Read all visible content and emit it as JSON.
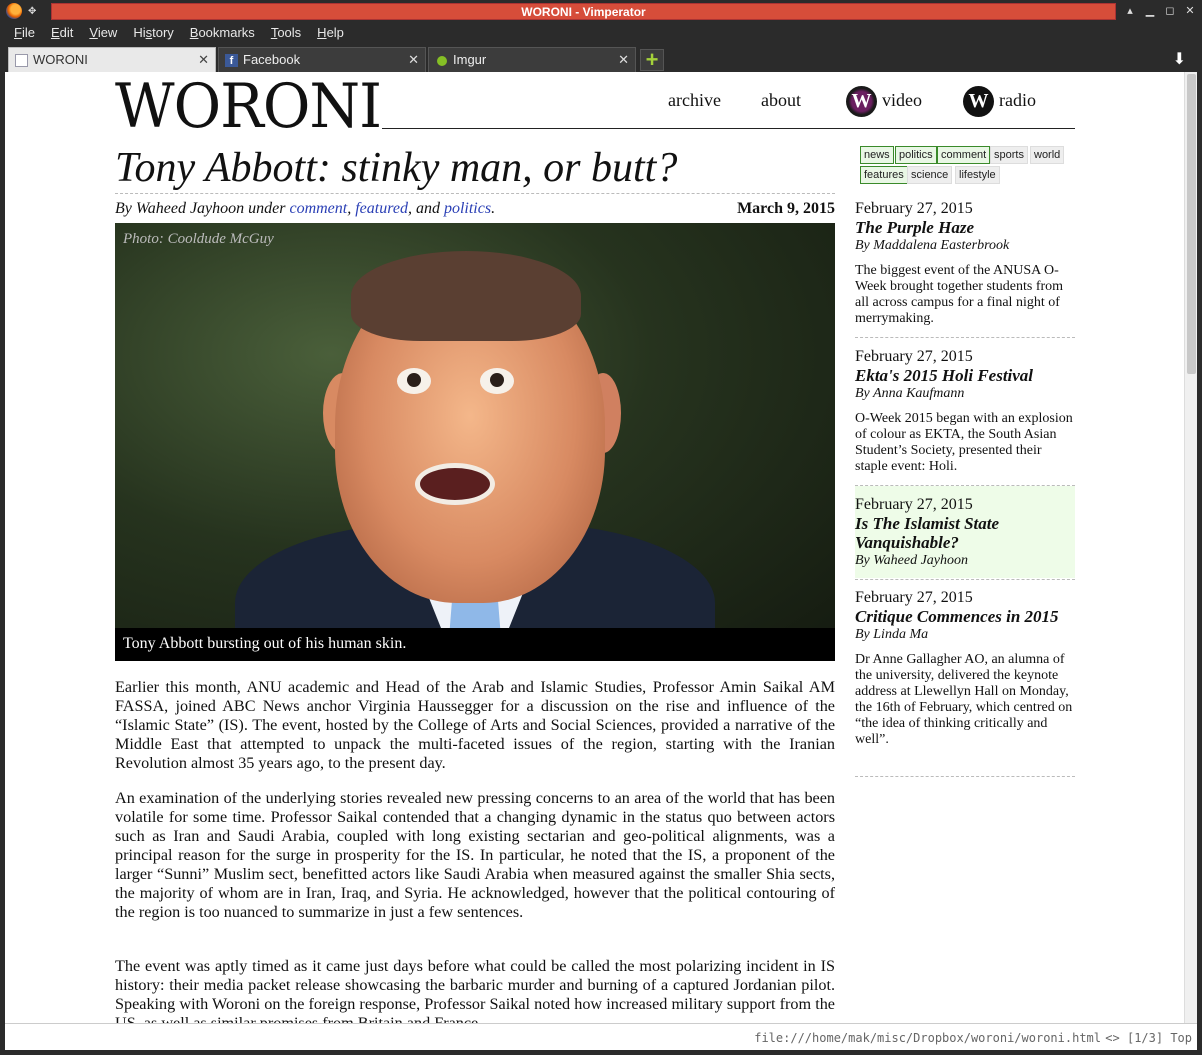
{
  "window": {
    "title": "WORONI - Vimperator"
  },
  "menubar": [
    {
      "mn": "F",
      "rest": "ile"
    },
    {
      "mn": "E",
      "rest": "dit"
    },
    {
      "mn": "V",
      "rest": "iew"
    },
    {
      "pre": "Hi",
      "mn": "s",
      "rest": "tory"
    },
    {
      "mn": "B",
      "rest": "ookmarks"
    },
    {
      "mn": "T",
      "rest": "ools"
    },
    {
      "mn": "H",
      "rest": "elp"
    }
  ],
  "tabs": [
    {
      "label": "WORONI",
      "icon": "page-icon"
    },
    {
      "label": "Facebook",
      "icon": "facebook-icon"
    },
    {
      "label": "Imgur",
      "icon": "imgur-icon"
    }
  ],
  "site": {
    "logo": "WORONI",
    "nav": {
      "archive": "archive",
      "about": "about",
      "video": "video",
      "radio": "radio",
      "badge": "W"
    }
  },
  "article": {
    "title": "Tony Abbott: stinky man, or butt?",
    "byline_prefix": "By Waheed Jayhoon under ",
    "cat1": "comment",
    "sep1": ", ",
    "cat2": "featured",
    "sep2": ", and ",
    "cat3": "politics",
    "byline_end": ".",
    "date": "March 9, 2015",
    "photo_credit": "Photo: Cooldude McGuy",
    "caption": "Tony Abbott bursting out of his human skin.",
    "paragraphs": [
      "Earlier this month, ANU academic and Head of the Arab and Islamic Studies, Professor Amin Saikal AM FASSA, joined ABC News anchor Virginia Haussegger for a discussion on the rise and influence of the “Islamic State” (IS). The event, hosted by the College of Arts and Social Sciences, provided a narrative of the Middle East that attempted to unpack the multi-faceted issues of the region, starting with the Iranian Revolution almost 35 years ago, to the present day.",
      "An examination of the underlying stories revealed new pressing concerns to an area of the world that has been volatile for some time. Professor Saikal contended that a changing dynamic in the status quo between actors such as Iran and Saudi Arabia, coupled with long existing sectarian and geo-political alignments, was a principal reason for the surge in prosperity for the IS. In particular, he noted that the IS, a proponent of the larger “Sunni” Muslim sect, benefitted actors like Saudi Arabia when measured against the smaller Shia sects, the majority of whom are in Iran, Iraq, and Syria. He acknowledged, however that the political contouring of the region is too nuanced to summarize in just a few sentences.",
      "The event was aptly timed as it came just days before what could be called the most polarizing incident in IS history: their media packet release showcasing the barbaric murder and burning of a captured Jordanian pilot. Speaking with Woroni on the foreign response, Professor Saikal noted how increased military support from the US, as well as similar promises from Britain and France"
    ]
  },
  "sidebar": {
    "tags": [
      {
        "label": "news",
        "active": true
      },
      {
        "label": "politics",
        "active": true
      },
      {
        "label": "comment",
        "active": true
      },
      {
        "label": "sports",
        "active": false
      },
      {
        "label": "world",
        "active": false
      },
      {
        "label": "features",
        "active": true
      },
      {
        "label": "science",
        "active": false
      },
      {
        "label": "lifestyle",
        "active": false
      }
    ],
    "items": [
      {
        "date": "February 27, 2015",
        "title": "The Purple Haze",
        "author": "By Maddalena Easterbrook",
        "excerpt": "The biggest event of the ANUSA O-Week brought together students from all across campus for a final night of merrymaking."
      },
      {
        "date": "February 27, 2015",
        "title": "Ekta's 2015 Holi Festival",
        "author": "By Anna Kaufmann",
        "excerpt": "O-Week 2015 began with an explosion of colour as EKTA, the South Asian Student’s Society, presented their staple event: Holi."
      },
      {
        "date": "February 27, 2015",
        "title": "Is The Islamist State Vanquishable?",
        "author": "By Waheed Jayhoon",
        "excerpt": ""
      },
      {
        "date": "February 27, 2015",
        "title": "Critique Commences in 2015",
        "author": "By Linda Ma",
        "excerpt": "Dr Anne Gallagher AO, an alumna of the university, delivered the keynote address at Llewellyn Hall on Monday, the 16th of February, which centred on “the idea of thinking critically and well”."
      }
    ]
  },
  "status": {
    "url": "file:///home/mak/misc/Dropbox/woroni/woroni.html",
    "position": "<> [1/3] Top"
  },
  "colors": {
    "title_bar": "#d64d3a",
    "link": "#2a3fb5",
    "tag_active_border": "#3a8a2a",
    "highlight": "#eefce8"
  }
}
